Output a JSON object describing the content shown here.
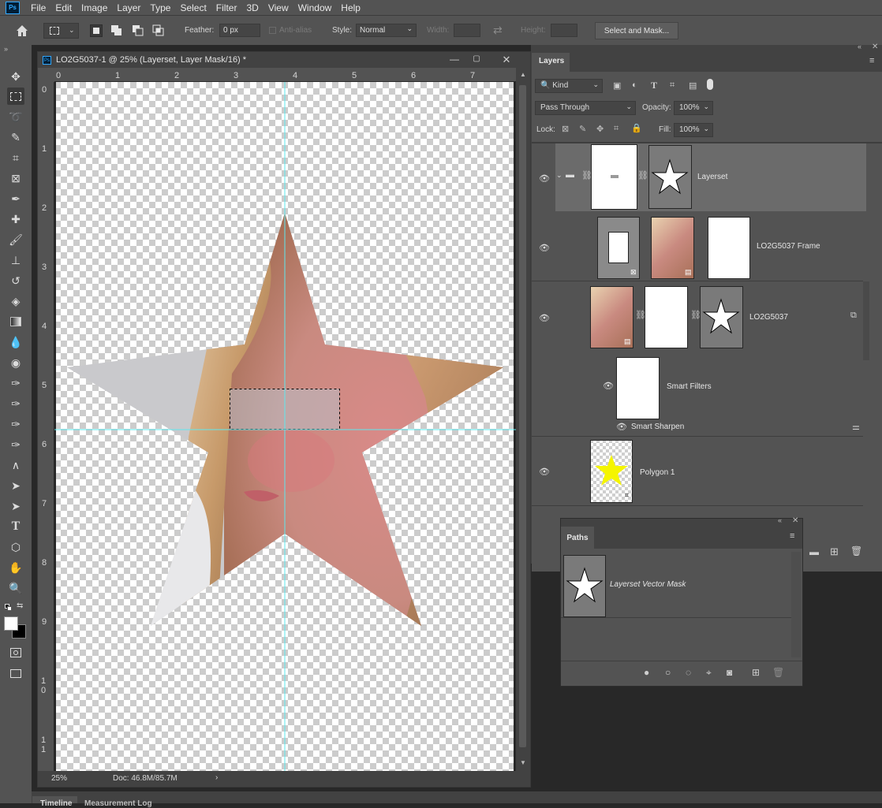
{
  "app": {
    "logo_text": "Ps",
    "menu": [
      "File",
      "Edit",
      "Image",
      "Layer",
      "Type",
      "Select",
      "Filter",
      "3D",
      "View",
      "Window",
      "Help"
    ]
  },
  "options_bar": {
    "feather_label": "Feather:",
    "feather_value": "0 px",
    "antialias_label": "Anti-alias",
    "style_label": "Style:",
    "style_value": "Normal",
    "width_label": "Width:",
    "height_label": "Height:",
    "select_mask_label": "Select and Mask..."
  },
  "document": {
    "title": "LO2G5037-1 @ 25% (Layerset, Layer Mask/16) *",
    "h_ruler": [
      "0",
      "1",
      "2",
      "3",
      "4",
      "5",
      "6",
      "7"
    ],
    "v_ruler": [
      "0",
      "1",
      "2",
      "3",
      "4",
      "5",
      "6",
      "7",
      "8",
      "9",
      "10",
      "11"
    ],
    "zoom": "25%",
    "doc_size": "Doc: 46.8M/85.7M"
  },
  "layers_panel": {
    "tab_label": "Layers",
    "filter_kind": "Kind",
    "blend_mode": "Pass Through",
    "opacity_label": "Opacity:",
    "opacity_value": "100%",
    "lock_label": "Lock:",
    "fill_label": "Fill:",
    "fill_value": "100%",
    "layers": [
      {
        "name": "Layerset"
      },
      {
        "name": "LO2G5037 Frame"
      },
      {
        "name": "LO2G5037"
      },
      {
        "name": "Smart Filters"
      },
      {
        "name": "Smart Sharpen"
      },
      {
        "name": "Polygon 1"
      }
    ]
  },
  "paths_panel": {
    "tab_label": "Paths",
    "path_name": "Layerset Vector Mask"
  },
  "bottom_tabs": [
    "Timeline",
    "Measurement Log"
  ],
  "colors": {
    "ui_dark": "#282828",
    "ui_mid": "#424242",
    "ui_panel": "#535353",
    "guide": "#5ee8ee",
    "star_fill": "#f5f500",
    "accent": "#31a8ff"
  }
}
